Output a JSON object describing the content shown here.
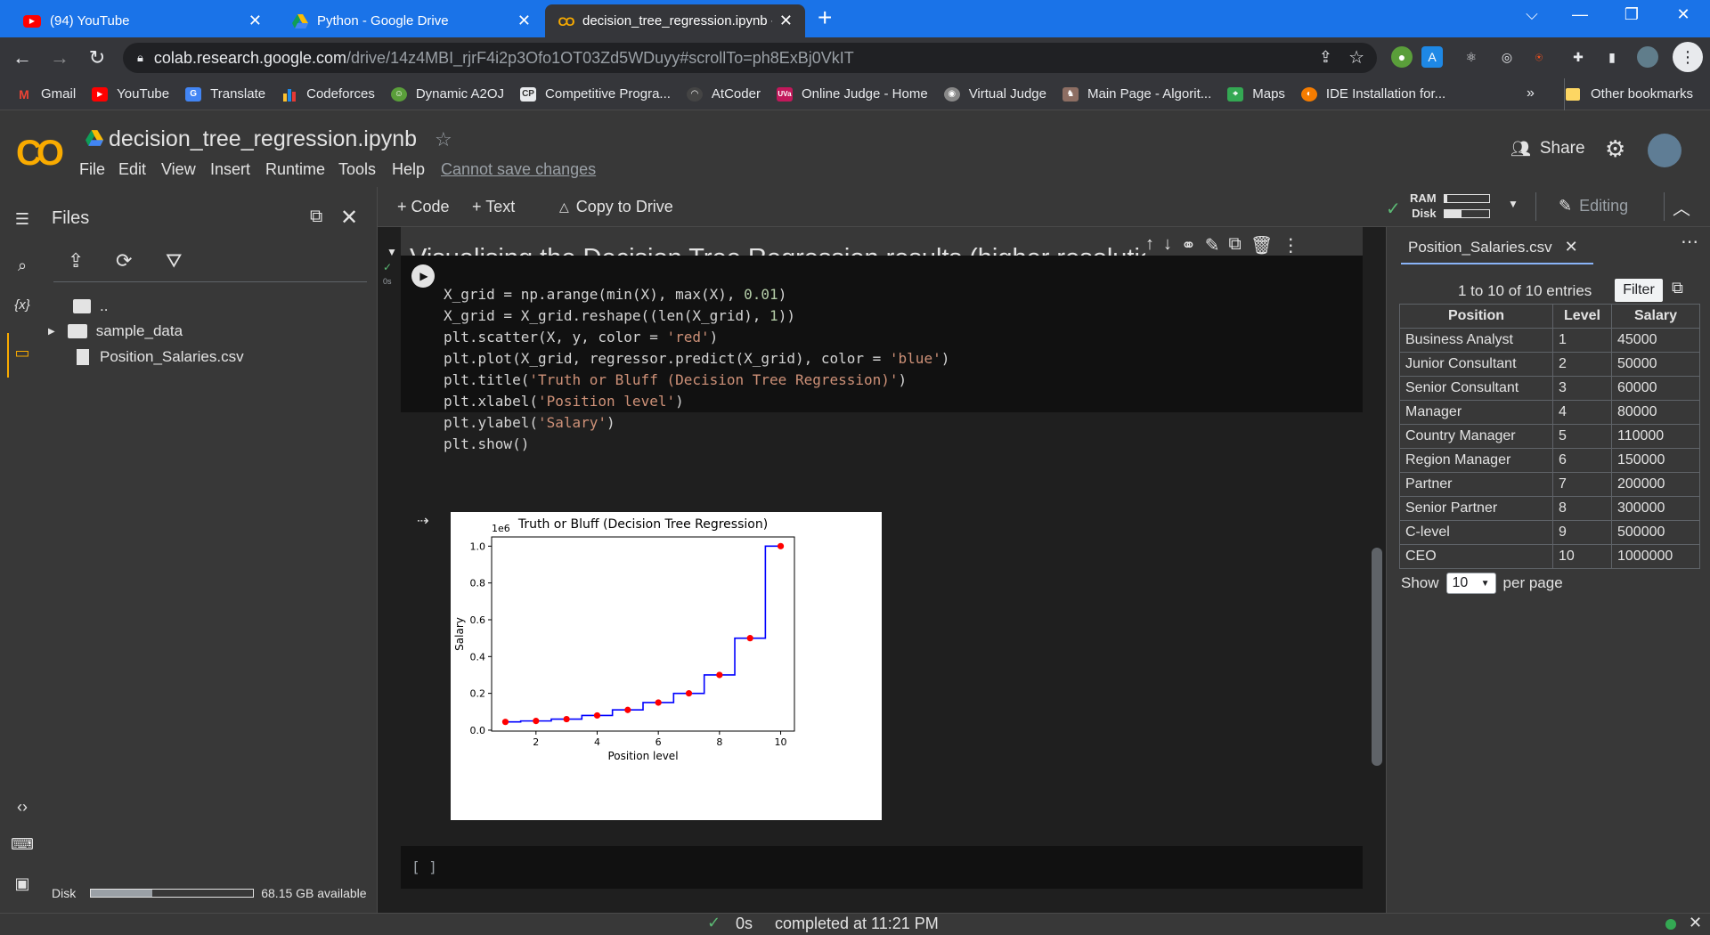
{
  "browser": {
    "tabs": [
      {
        "title": "(94) YouTube",
        "icon": "youtube-icon",
        "active": false
      },
      {
        "title": "Python - Google Drive",
        "icon": "google-drive-icon",
        "active": false
      },
      {
        "title": "decision_tree_regression.ipynb - C",
        "icon": "colab-icon",
        "active": true
      }
    ],
    "new_tab": "+",
    "url_host": "colab.research.google.com",
    "url_path": "/drive/14z4MBI_rjrF4i2p3Ofo1OT03Zd5WDuyy#scrollTo=ph8ExBj0VkIT",
    "bookmarks": [
      {
        "label": "Gmail",
        "icon": "gmail-icon",
        "color": "#ea4335"
      },
      {
        "label": "YouTube",
        "icon": "youtube-icon",
        "color": "#ff0000"
      },
      {
        "label": "Translate",
        "icon": "translate-icon",
        "color": "#4285f4"
      },
      {
        "label": "Codeforces",
        "icon": "codeforces-icon",
        "color": "#1f8acb"
      },
      {
        "label": "Dynamic A2OJ",
        "icon": "a2oj-icon",
        "color": "#5a9e3a"
      },
      {
        "label": "Competitive Progra...",
        "icon": "cp-icon",
        "color": "#666666"
      },
      {
        "label": "AtCoder",
        "icon": "atcoder-icon",
        "color": "#444444"
      },
      {
        "label": "Online Judge - Home",
        "icon": "uva-icon",
        "color": "#c2185b"
      },
      {
        "label": "Virtual Judge",
        "icon": "vjudge-icon",
        "color": "#888888"
      },
      {
        "label": "Main Page - Algorit...",
        "icon": "algorithmist-icon",
        "color": "#8d6e63"
      },
      {
        "label": "Maps",
        "icon": "maps-icon",
        "color": "#34a853"
      },
      {
        "label": "IDE Installation for...",
        "icon": "ide-icon",
        "color": "#f57c00"
      }
    ],
    "more_bookmarks": "»",
    "other_bookmarks": "Other bookmarks"
  },
  "colab": {
    "logo": "CO",
    "notebook_title": "decision_tree_regression.ipynb",
    "menu": [
      "File",
      "Edit",
      "View",
      "Insert",
      "Runtime",
      "Tools",
      "Help"
    ],
    "cannot_save": "Cannot save changes",
    "share": "Share",
    "add_code": "+ Code",
    "add_text": "+ Text",
    "copy_to_drive": "Copy to Drive",
    "ram_label": "RAM",
    "disk_label": "Disk",
    "editing": "Editing"
  },
  "files_panel": {
    "title": "Files",
    "items": [
      {
        "name": "..",
        "type": "parent-folder"
      },
      {
        "name": "sample_data",
        "type": "folder"
      },
      {
        "name": "Position_Salaries.csv",
        "type": "file"
      }
    ],
    "disk_label": "Disk",
    "disk_available": "68.15 GB available",
    "disk_used_fraction": 0.38
  },
  "notebook": {
    "section_heading": "Visualising the Decision Tree Regression results (higher resolution)",
    "exec_time": "0s",
    "code_lines": [
      "X_grid = np.arange(min(X), max(X), 0.01)",
      "X_grid = X_grid.reshape((len(X_grid), 1))",
      "plt.scatter(X, y, color = 'red')",
      "plt.plot(X_grid, regressor.predict(X_grid), color = 'blue')",
      "plt.title('Truth or Bluff (Decision Tree Regression)')",
      "plt.xlabel('Position level')",
      "plt.ylabel('Salary')",
      "plt.show()"
    ],
    "empty_cell": "[ ]"
  },
  "chart_data": {
    "type": "scatter",
    "title": "Truth or Bluff (Decision Tree Regression)",
    "xlabel": "Position level",
    "ylabel": "Salary",
    "y_offset_label": "1e6",
    "xlim": [
      0.55,
      10.45
    ],
    "ylim": [
      -0.005,
      1.05
    ],
    "xticks": [
      2,
      4,
      6,
      8,
      10
    ],
    "yticks": [
      0.0,
      0.2,
      0.4,
      0.6,
      0.8,
      1.0
    ],
    "ytick_labels": [
      "0.0",
      "0.2",
      "0.4",
      "0.6",
      "0.8",
      "1.0"
    ],
    "series": [
      {
        "kind": "scatter",
        "color": "#ff0000",
        "x": [
          1,
          2,
          3,
          4,
          5,
          6,
          7,
          8,
          9,
          10
        ],
        "y": [
          0.045,
          0.05,
          0.06,
          0.08,
          0.11,
          0.15,
          0.2,
          0.3,
          0.5,
          1.0
        ]
      },
      {
        "kind": "step",
        "color": "#0000ff",
        "x": [
          1,
          2,
          3,
          4,
          5,
          6,
          7,
          8,
          9,
          10
        ],
        "y": [
          0.045,
          0.05,
          0.06,
          0.08,
          0.11,
          0.15,
          0.2,
          0.3,
          0.5,
          1.0
        ]
      }
    ],
    "grid": false
  },
  "csv_viewer": {
    "tab_name": "Position_Salaries.csv",
    "entries_text": "1 to 10 of 10 entries",
    "filter_label": "Filter",
    "columns": [
      "Position",
      "Level",
      "Salary"
    ],
    "rows": [
      [
        "Business Analyst",
        "1",
        "45000"
      ],
      [
        "Junior Consultant",
        "2",
        "50000"
      ],
      [
        "Senior Consultant",
        "3",
        "60000"
      ],
      [
        "Manager",
        "4",
        "80000"
      ],
      [
        "Country Manager",
        "5",
        "110000"
      ],
      [
        "Region Manager",
        "6",
        "150000"
      ],
      [
        "Partner",
        "7",
        "200000"
      ],
      [
        "Senior Partner",
        "8",
        "300000"
      ],
      [
        "C-level",
        "9",
        "500000"
      ],
      [
        "CEO",
        "10",
        "1000000"
      ]
    ],
    "show_label": "Show",
    "per_page_value": "10",
    "per_page_label": "per page"
  },
  "status": {
    "time": "0s",
    "message": "completed at 11:21 PM"
  }
}
